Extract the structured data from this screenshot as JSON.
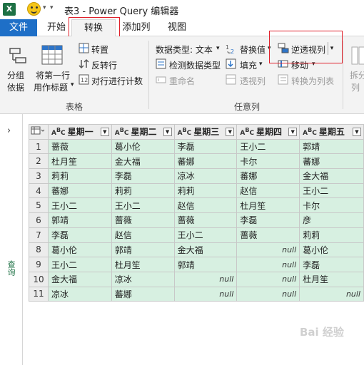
{
  "titlebar": {
    "logo_letter": "X",
    "title": "表3 - Power Query 编辑器"
  },
  "tabs": {
    "file": "文件",
    "home": "开始",
    "transform": "转换",
    "add_column": "添加列",
    "view": "视图"
  },
  "ribbon": {
    "table_group": {
      "group_by": [
        "分组",
        "依据"
      ],
      "use_first_row": [
        "将第一行",
        "用作标题"
      ],
      "transpose": "转置",
      "reverse_rows": "反转行",
      "count_rows": "对行进行计数",
      "label": "表格"
    },
    "any_column_group": {
      "data_type": "数据类型: 文本",
      "detect_type": "检测数据类型",
      "rename": "重命名",
      "replace_values": "替换值",
      "fill": "填充",
      "pivot_column": "透视列",
      "unpivot_columns": "逆透视列",
      "move": "移动",
      "convert_to_list": "转换为列表",
      "label": "任意列"
    },
    "split_column": [
      "拆分",
      "列"
    ]
  },
  "sidepanel": {
    "label": "查询"
  },
  "table": {
    "headers": [
      "星期一",
      "星期二",
      "星期三",
      "星期四",
      "星期五"
    ],
    "type_prefix": "A",
    "type_sup": "B",
    "type_sub": "C",
    "rows": [
      [
        "1",
        "蔷薇",
        "葛小伦",
        "李磊",
        "王小二",
        "郭靖"
      ],
      [
        "2",
        "杜月笙",
        "金大福",
        "蕃娜",
        "卡尔",
        "蕃娜"
      ],
      [
        "3",
        "莉莉",
        "李磊",
        "凉冰",
        "蕃娜",
        "金大福"
      ],
      [
        "4",
        "蕃娜",
        "莉莉",
        "莉莉",
        "赵信",
        "王小二"
      ],
      [
        "5",
        "王小二",
        "王小二",
        "赵信",
        "杜月笙",
        "卡尔"
      ],
      [
        "6",
        "郭靖",
        "蔷薇",
        "蔷薇",
        "李磊",
        "彦"
      ],
      [
        "7",
        "李磊",
        "赵信",
        "王小二",
        "蔷薇",
        "莉莉"
      ],
      [
        "8",
        "葛小伦",
        "郭靖",
        "金大福",
        "null",
        "葛小伦"
      ],
      [
        "9",
        "王小二",
        "杜月笙",
        "郭靖",
        "null",
        "李磊"
      ],
      [
        "10",
        "金大福",
        "凉冰",
        "null",
        "null",
        "杜月笙"
      ],
      [
        "11",
        "凉冰",
        "蕃娜",
        "null",
        "null",
        "null"
      ]
    ]
  },
  "watermark": "Bai 经验"
}
